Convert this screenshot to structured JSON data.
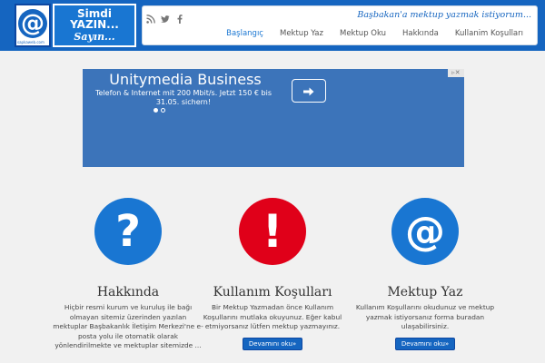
{
  "header": {
    "logo": {
      "at_symbol": "@",
      "small_text": "sapkaweb.com",
      "line1": "Simdi",
      "line2": "YAZIN...",
      "line3": "Sayın..."
    },
    "tagline": "Başbakan'a mektup yazmak istiyorum...",
    "social_icons": [
      "rss-icon",
      "twitter-icon",
      "facebook-icon"
    ],
    "nav": [
      {
        "label": "Başlangıç",
        "active": true
      },
      {
        "label": "Mektup Yaz",
        "active": false
      },
      {
        "label": "Mektup Oku",
        "active": false
      },
      {
        "label": "Hakkında",
        "active": false
      },
      {
        "label": "Kullanim Koşulları",
        "active": false
      }
    ]
  },
  "ad": {
    "title": "Unitymedia Business",
    "subtitle": "Telefon & Internet mit 200 Mbit/s. Jetzt 150 € bis 31.05. sichern!",
    "badge": "▹✕",
    "button_icon": "arrow-right-icon",
    "colors": {
      "background": "#3c74ba"
    }
  },
  "columns": [
    {
      "icon": "question-icon",
      "glyph": "?",
      "color": "#1976d2",
      "title": "Hakkında",
      "text": "Hiçbir resmi kurum ve kuruluş ile bağı olmayan sitemiz üzerinden yazılan mektuplar Başbakanlık İletişim Merkezi'ne e-posta yolu ile otomatik olarak yönlendirilmekte ve mektuplar sitemizde ...",
      "button": "Devamını oku»"
    },
    {
      "icon": "exclamation-icon",
      "glyph": "!",
      "color": "#e00019",
      "title": "Kullanım Koşulları",
      "text": "Bir Mektup Yazmadan önce Kullanım Koşullarını mutlaka okuyunuz. Eğer kabul etmiyorsanız lütfen mektup yazmayınız.",
      "button": "Devamını oku»"
    },
    {
      "icon": "at-sign-icon",
      "glyph": "@",
      "color": "#1976d2",
      "title": "Mektup Yaz",
      "text": "Kullanım Koşullarını okudunuz ve mektup yazmak istiyorsanız forma buradan ulaşabilirsiniz.",
      "button": "Devamını oku»"
    }
  ]
}
